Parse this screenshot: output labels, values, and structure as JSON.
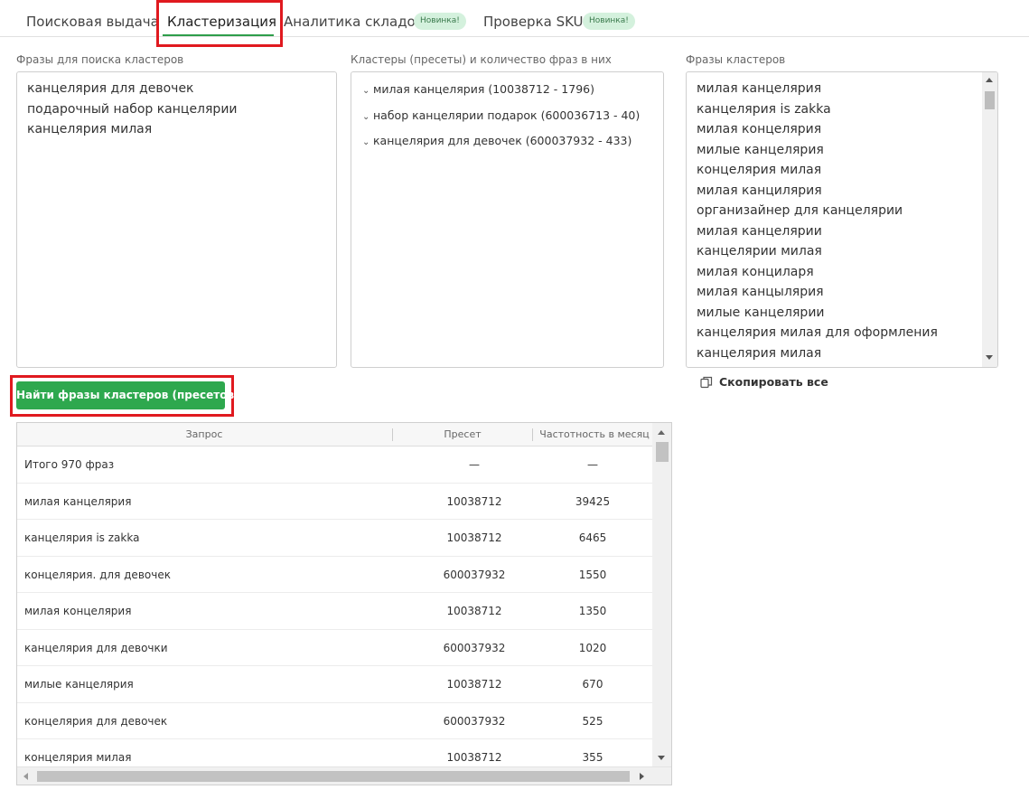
{
  "tabs": [
    {
      "label": "Поисковая выдача"
    },
    {
      "label": "Кластеризация"
    },
    {
      "label": "Аналитика складов",
      "badge": "Новинка!"
    },
    {
      "label": "Проверка SKU",
      "badge": "Новинка!"
    }
  ],
  "labels": {
    "input": "Фразы для поиска кластеров",
    "clusters": "Кластеры (пресеты) и количество фраз в них",
    "cluster_phrases": "Фразы кластеров"
  },
  "input_phrases": [
    "канцелярия для девочек",
    "подарочный набор канцелярии",
    "канцелярия милая"
  ],
  "clusters": [
    "милая канцелярия (10038712 - 1796)",
    "набор канцелярии подарок (600036713 - 40)",
    "канцелярия для девочек (600037932 - 433)"
  ],
  "cluster_phrases": [
    "милая канцелярия",
    "канцелярия is zakka",
    "милая концелярия",
    "милые канцелярия",
    "концелярия милая",
    "милая канцилярия",
    "организайнер для канцелярии",
    "милая канцелярии",
    "канцелярии милая",
    "милая конциларя",
    "милая канцылярия",
    "милые канцелярии",
    "канцелярия милая для оформления",
    "канцелярия  милая"
  ],
  "copy_label": "Скопировать все",
  "find_button": "Найти фразы кластеров (пресетов)",
  "table": {
    "headers": [
      "Запрос",
      "Пресет",
      "Частотность в месяц"
    ],
    "rows": [
      [
        "Итого 970 фраз",
        "—",
        "—"
      ],
      [
        "милая канцелярия",
        "10038712",
        "39425"
      ],
      [
        "канцелярия is zakka",
        "10038712",
        "6465"
      ],
      [
        "концелярия. для девочек",
        "600037932",
        "1550"
      ],
      [
        "милая концелярия",
        "10038712",
        "1350"
      ],
      [
        "канцелярия для девочки",
        "600037932",
        "1020"
      ],
      [
        "милые канцелярия",
        "10038712",
        "670"
      ],
      [
        "концелярия для девочек",
        "600037932",
        "525"
      ],
      [
        "концелярия милая",
        "10038712",
        "355"
      ]
    ]
  },
  "colors": {
    "accent": "#2ea84e",
    "highlight": "#e0191f",
    "badge_bg": "#d4f1dd"
  }
}
